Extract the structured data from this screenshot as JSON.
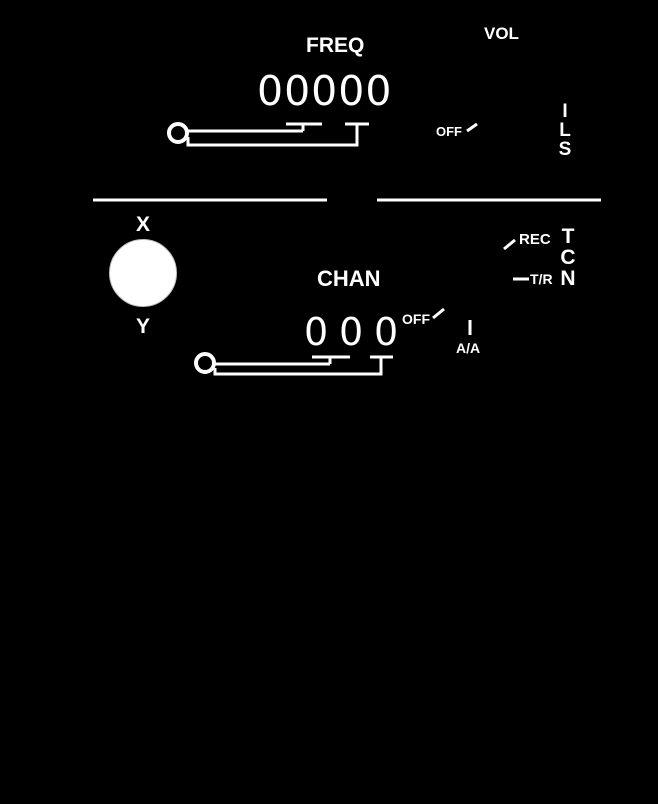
{
  "ils": {
    "freq_label": "FREQ",
    "freq_value": "00000",
    "vol_label": "VOL",
    "off_label": "OFF",
    "side_label": [
      "I",
      "L",
      "S"
    ]
  },
  "tacan": {
    "x_label": "X",
    "y_label": "Y",
    "chan_label": "CHAN",
    "chan_digits": [
      "0",
      "0",
      "0"
    ],
    "off_label": "OFF",
    "rec_label": "REC",
    "tr_label": "T/R",
    "aa_label": "A/A",
    "side_label": [
      "T",
      "C",
      "N"
    ]
  },
  "colors": {
    "background": "#000000",
    "foreground": "#ffffff"
  }
}
